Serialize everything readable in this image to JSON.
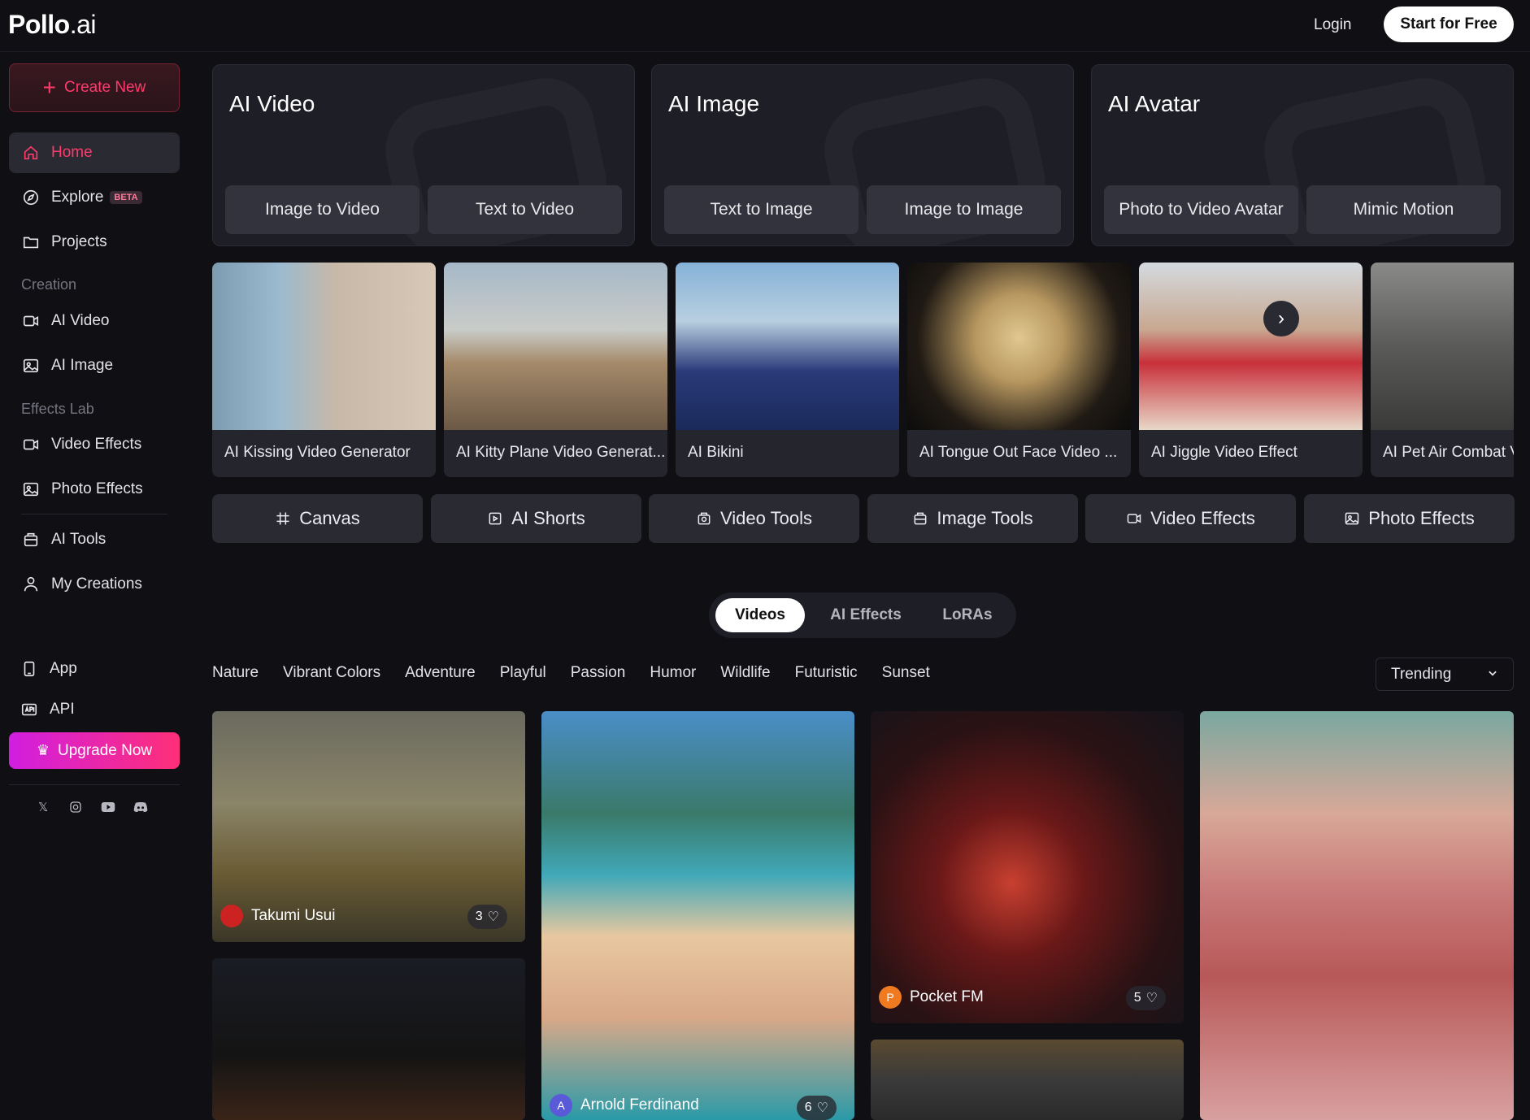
{
  "header": {
    "logo_main": "Pollo",
    "logo_suffix": ".ai",
    "login": "Login",
    "start": "Start for Free"
  },
  "sidebar": {
    "create": "Create New",
    "home": "Home",
    "explore": "Explore",
    "explore_badge": "BETA",
    "projects": "Projects",
    "creation_label": "Creation",
    "ai_video": "AI Video",
    "ai_image": "AI Image",
    "effects_label": "Effects Lab",
    "video_effects": "Video Effects",
    "photo_effects": "Photo Effects",
    "ai_tools": "AI Tools",
    "my_creations": "My Creations",
    "app": "App",
    "api": "API",
    "upgrade": "Upgrade Now"
  },
  "categories": [
    {
      "title": "AI Video",
      "buttons": [
        "Image to Video",
        "Text to Video"
      ]
    },
    {
      "title": "AI Image",
      "buttons": [
        "Text to Image",
        "Image to Image"
      ]
    },
    {
      "title": "AI Avatar",
      "buttons": [
        "Photo to Video Avatar",
        "Mimic Motion"
      ]
    }
  ],
  "carousel": [
    "AI Kissing Video Generator",
    "AI Kitty Plane Video Generat...",
    "AI Bikini",
    "AI Tongue Out Face Video ...",
    "AI Jiggle Video Effect",
    "AI Pet Air Combat V"
  ],
  "tools": [
    "Canvas",
    "AI Shorts",
    "Video Tools",
    "Image Tools",
    "Video Effects",
    "Photo Effects"
  ],
  "tabs": [
    "Videos",
    "AI Effects",
    "LoRAs"
  ],
  "filters": [
    "Nature",
    "Vibrant Colors",
    "Adventure",
    "Playful",
    "Passion",
    "Humor",
    "Wildlife",
    "Futuristic",
    "Sunset"
  ],
  "sort": "Trending",
  "gallery": {
    "c1": {
      "author": "Takumi Usui",
      "likes": "3"
    },
    "c2": {
      "author": "Arnold Ferdinand",
      "initial": "A",
      "likes": "6"
    },
    "c3": {
      "author": "Pocket FM",
      "initial": "P",
      "likes": "5"
    }
  },
  "colors": {
    "accent": "#ff3b6b",
    "background": "#0f0f14",
    "card": "#1e1e27"
  }
}
